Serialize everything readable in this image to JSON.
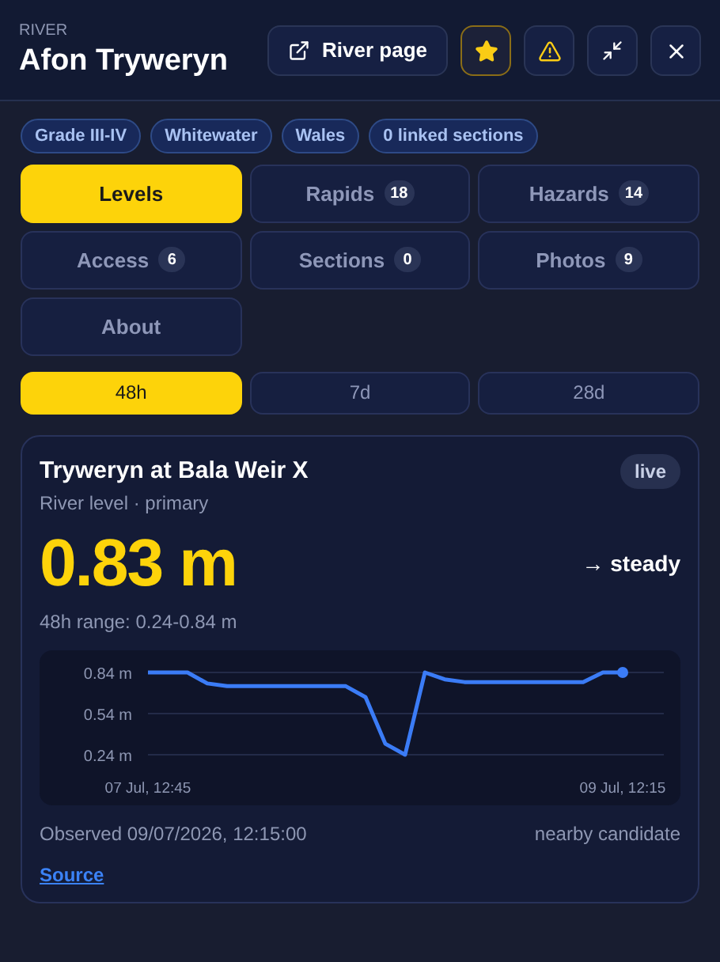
{
  "header": {
    "eyebrow": "RIVER",
    "title": "Afon Tryweryn",
    "river_page_button": "River page",
    "favorite": true
  },
  "tags": [
    "Grade III-IV",
    "Whitewater",
    "Wales",
    "0 linked sections"
  ],
  "tabs": [
    {
      "label": "Levels",
      "selected": true
    },
    {
      "label": "Rapids",
      "count": "18",
      "selected": false
    },
    {
      "label": "Hazards",
      "count": "14",
      "selected": false
    },
    {
      "label": "Access",
      "count": "6",
      "selected": false
    },
    {
      "label": "Sections",
      "count": "0",
      "selected": false
    },
    {
      "label": "Photos",
      "count": "9",
      "selected": false
    },
    {
      "label": "About",
      "selected": false
    }
  ],
  "ranges": [
    {
      "label": "48h",
      "selected": true
    },
    {
      "label": "7d",
      "selected": false
    },
    {
      "label": "28d",
      "selected": false
    }
  ],
  "gauge": {
    "name": "Tryweryn at Bala Weir X",
    "subtitle": "River level · primary",
    "badge": "live",
    "reading": "0.83 m",
    "trend": "→ steady",
    "range_text": "48h range: 0.24-0.84 m",
    "chart_data": {
      "type": "line",
      "categories": [
        "07 Jul, 12:45",
        null,
        null,
        null,
        null,
        null,
        null,
        null,
        null,
        null,
        null,
        null,
        null,
        null,
        null,
        null,
        null,
        null,
        null,
        null,
        null,
        null,
        null,
        null,
        "09 Jul, 12:15"
      ],
      "series": [
        {
          "color": "#3b7cf6",
          "values": [
            0.84,
            0.84,
            0.84,
            0.76,
            0.74,
            0.74,
            0.74,
            0.74,
            0.74,
            0.74,
            0.74,
            0.66,
            0.32,
            0.24,
            0.84,
            0.79,
            0.77,
            0.77,
            0.77,
            0.77,
            0.77,
            0.77,
            0.77,
            0.84,
            0.84
          ]
        }
      ],
      "ylim": [
        0.24,
        0.84
      ],
      "grid": true,
      "yticks": [
        {
          "value": 0.84,
          "label": "0.84 m"
        },
        {
          "value": 0.54,
          "label": "0.54 m"
        },
        {
          "value": 0.24,
          "label": "0.24 m"
        }
      ]
    },
    "observed": "Observed 09/07/2026, 12:15:00",
    "match": "nearby candidate",
    "source_link": "Source"
  }
}
